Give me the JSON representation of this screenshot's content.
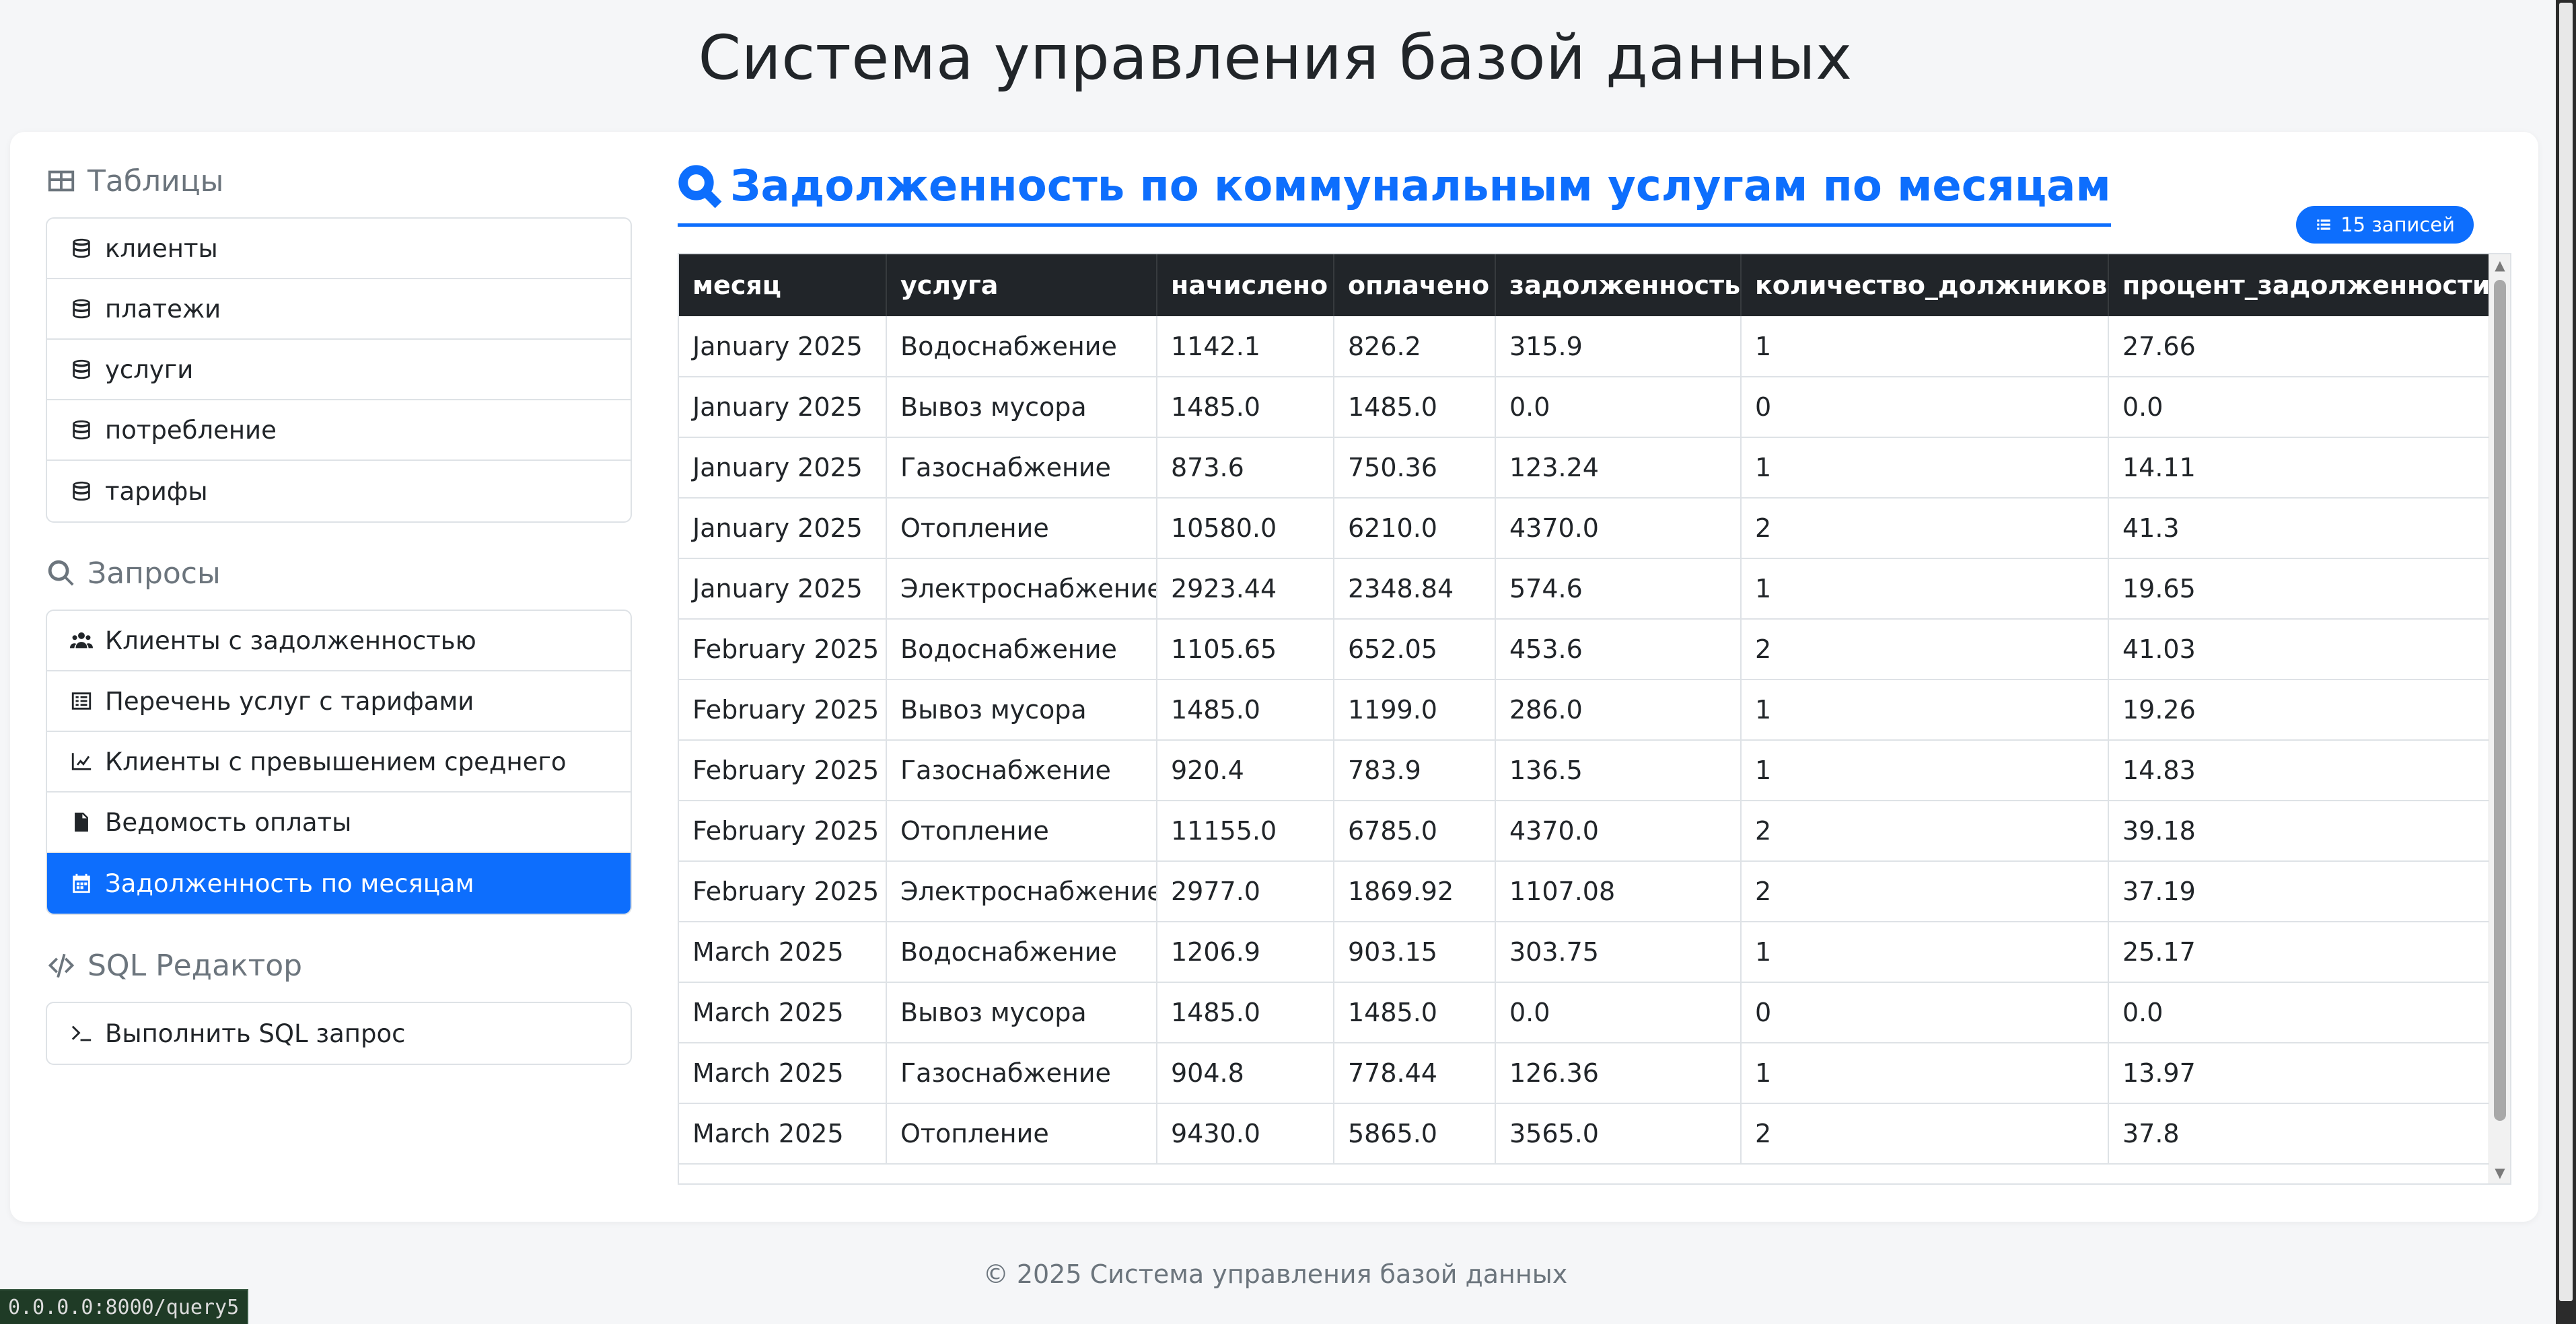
{
  "app_title": "Система управления базой данных",
  "sidebar": {
    "tables": {
      "title": "Таблицы",
      "items": [
        {
          "label": "клиенты",
          "icon": "database-icon"
        },
        {
          "label": "платежи",
          "icon": "database-icon"
        },
        {
          "label": "услуги",
          "icon": "database-icon"
        },
        {
          "label": "потребление",
          "icon": "database-icon"
        },
        {
          "label": "тарифы",
          "icon": "database-icon"
        }
      ]
    },
    "queries": {
      "title": "Запросы",
      "items": [
        {
          "label": "Клиенты с задолженностью",
          "icon": "users-icon"
        },
        {
          "label": "Перечень услуг с тарифами",
          "icon": "list-alt-icon"
        },
        {
          "label": "Клиенты с превышением среднего",
          "icon": "chart-line-icon"
        },
        {
          "label": "Ведомость оплаты",
          "icon": "file-invoice-icon"
        },
        {
          "label": "Задолженность по месяцам",
          "icon": "calendar-icon",
          "active": true
        }
      ]
    },
    "sql": {
      "title": "SQL Редактор",
      "items": [
        {
          "label": "Выполнить SQL запрос",
          "icon": "terminal-icon"
        }
      ]
    }
  },
  "main": {
    "title": "Задолженность по коммунальным услугам по месяцам",
    "badge": "15 записей",
    "columns": [
      "месяц",
      "услуга",
      "начислено",
      "оплачено",
      "задолженность",
      "количество_должников",
      "процент_задолженности"
    ],
    "rows": [
      [
        "January 2025",
        "Водоснабжение",
        "1142.1",
        "826.2",
        "315.9",
        "1",
        "27.66"
      ],
      [
        "January 2025",
        "Вывоз мусора",
        "1485.0",
        "1485.0",
        "0.0",
        "0",
        "0.0"
      ],
      [
        "January 2025",
        "Газоснабжение",
        "873.6",
        "750.36",
        "123.24",
        "1",
        "14.11"
      ],
      [
        "January 2025",
        "Отопление",
        "10580.0",
        "6210.0",
        "4370.0",
        "2",
        "41.3"
      ],
      [
        "January 2025",
        "Электроснабжение",
        "2923.44",
        "2348.84",
        "574.6",
        "1",
        "19.65"
      ],
      [
        "February 2025",
        "Водоснабжение",
        "1105.65",
        "652.05",
        "453.6",
        "2",
        "41.03"
      ],
      [
        "February 2025",
        "Вывоз мусора",
        "1485.0",
        "1199.0",
        "286.0",
        "1",
        "19.26"
      ],
      [
        "February 2025",
        "Газоснабжение",
        "920.4",
        "783.9",
        "136.5",
        "1",
        "14.83"
      ],
      [
        "February 2025",
        "Отопление",
        "11155.0",
        "6785.0",
        "4370.0",
        "2",
        "39.18"
      ],
      [
        "February 2025",
        "Электроснабжение",
        "2977.0",
        "1869.92",
        "1107.08",
        "2",
        "37.19"
      ],
      [
        "March 2025",
        "Водоснабжение",
        "1206.9",
        "903.15",
        "303.75",
        "1",
        "25.17"
      ],
      [
        "March 2025",
        "Вывоз мусора",
        "1485.0",
        "1485.0",
        "0.0",
        "0",
        "0.0"
      ],
      [
        "March 2025",
        "Газоснабжение",
        "904.8",
        "778.44",
        "126.36",
        "1",
        "13.97"
      ],
      [
        "March 2025",
        "Отопление",
        "9430.0",
        "5865.0",
        "3565.0",
        "2",
        "37.8"
      ]
    ]
  },
  "footer": "© 2025 Система управления базой данных",
  "status_url": "0.0.0.0:8000/query5"
}
